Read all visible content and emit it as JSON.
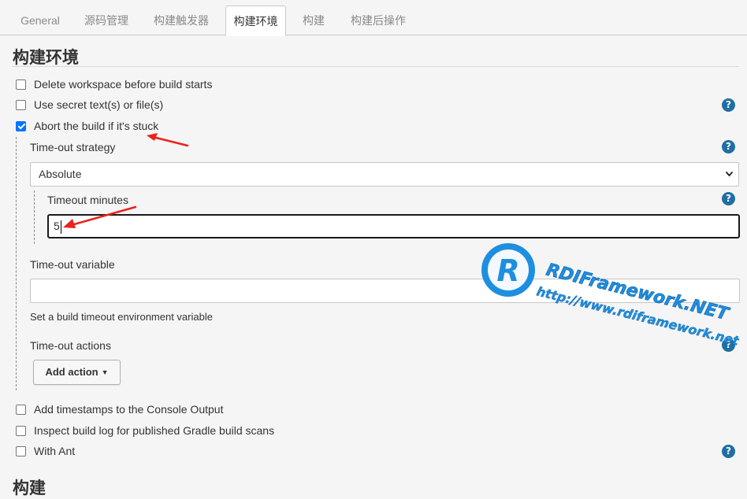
{
  "tabs": [
    {
      "label": "General",
      "active": false
    },
    {
      "label": "源码管理",
      "active": false
    },
    {
      "label": "构建触发器",
      "active": false
    },
    {
      "label": "构建环境",
      "active": true
    },
    {
      "label": "构建",
      "active": false
    },
    {
      "label": "构建后操作",
      "active": false
    }
  ],
  "section": {
    "title": "构建环境"
  },
  "options": {
    "delete_workspace": {
      "label": "Delete workspace before build starts",
      "checked": false
    },
    "secret_text": {
      "label": "Use secret text(s) or file(s)",
      "checked": false
    },
    "abort_stuck": {
      "label": "Abort the build if it's stuck",
      "checked": true
    },
    "timestamps": {
      "label": "Add timestamps to the Console Output",
      "checked": false
    },
    "gradle_scans": {
      "label": "Inspect build log for published Gradle build scans",
      "checked": false
    },
    "with_ant": {
      "label": "With Ant",
      "checked": false
    }
  },
  "timeout": {
    "strategy_label": "Time-out strategy",
    "strategy_value": "Absolute",
    "minutes_label": "Timeout minutes",
    "minutes_value": "5",
    "variable_label": "Time-out variable",
    "variable_value": "",
    "variable_description": "Set a build timeout environment variable",
    "actions_label": "Time-out actions",
    "add_action_label": "Add action"
  },
  "help_glyph": "?",
  "next_section": {
    "title": "构建"
  },
  "watermark": {
    "logo_letter": "R",
    "line1": "RDIFramework.NET",
    "line2": "http://www.rdiframework.net"
  },
  "colors": {
    "checkbox_checked": "#0075ff",
    "help_icon": "#1f6fa3",
    "annotation_arrow": "#e8231c",
    "watermark_blue": "#1e8fe0"
  }
}
